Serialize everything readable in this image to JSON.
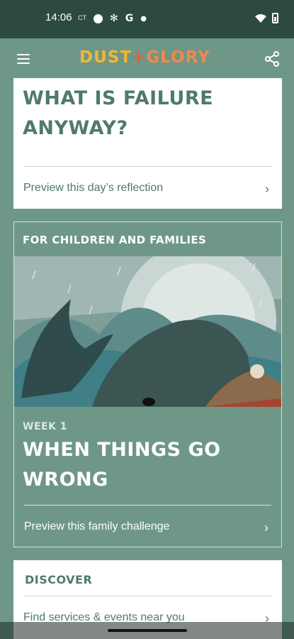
{
  "status_bar": {
    "time": "14:06",
    "carrier_tag": "CT",
    "icons": [
      "circle-icon",
      "settings-icon",
      "google-icon",
      "dot-icon",
      "wifi-icon",
      "battery-icon"
    ],
    "g_label": "G"
  },
  "app_bar": {
    "logo_part1": "DUST",
    "logo_plus": "+",
    "logo_part2": "GLORY",
    "icons": [
      "hamburger-menu-icon",
      "share-icon"
    ]
  },
  "reflection_card": {
    "title": "WHAT IS FAILURE ANYWAY?",
    "preview_label": "Preview this day’s reflection"
  },
  "family_card": {
    "section_heading": "FOR CHILDREN AND FAMILIES",
    "week_label": "WEEK 1",
    "title": "WHEN THINGS GO WRONG",
    "preview_label": "Preview this family challenge"
  },
  "discover_card": {
    "heading": "DISCOVER",
    "link_label": "Find services & events near you"
  },
  "colors": {
    "background": "#6e9787",
    "status_bar": "#2c4a41",
    "card_text": "#4f7a6a",
    "logo_yellow": "#f2b634",
    "logo_orange": "#f08a4b",
    "logo_red": "#e85a3d"
  }
}
